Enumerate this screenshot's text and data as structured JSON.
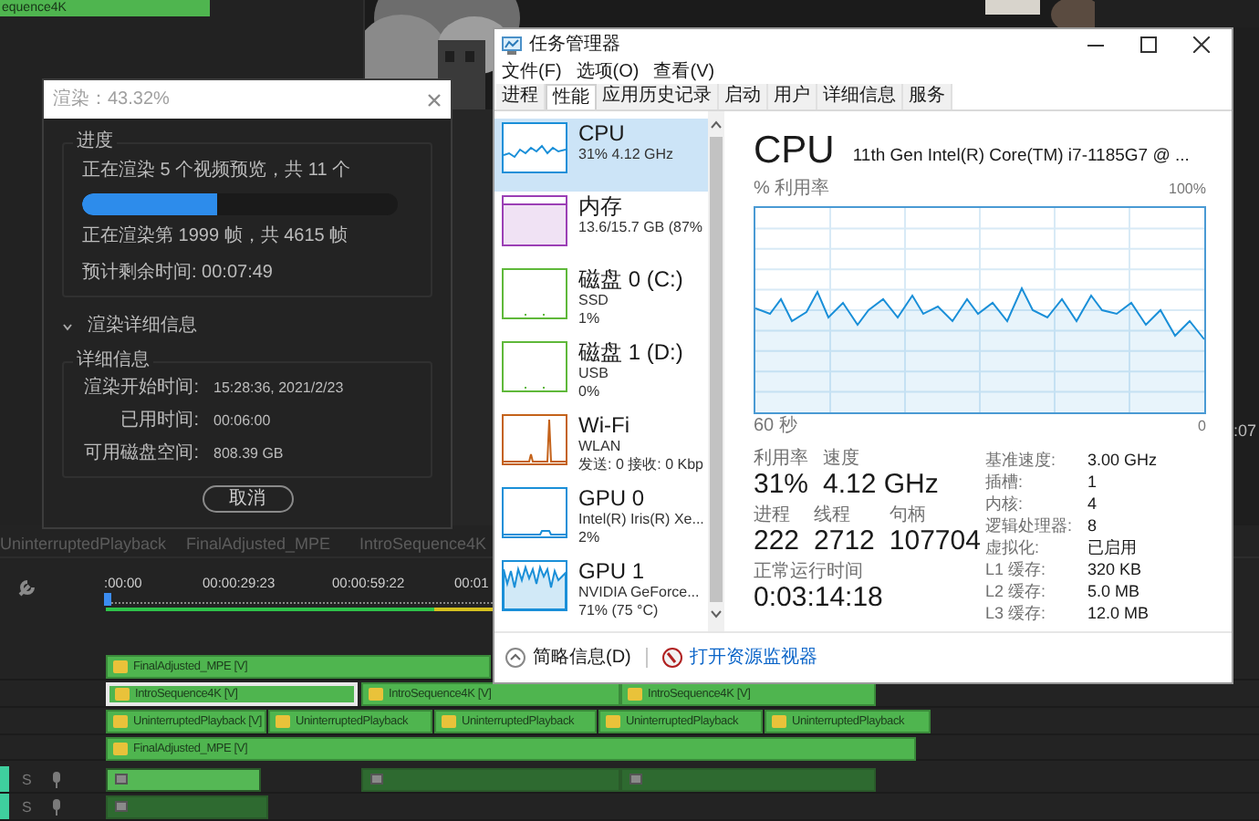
{
  "top_clip": {
    "label": "equence4K"
  },
  "render_dialog": {
    "title": "渲染：43.32%",
    "progress_legend": "进度",
    "status": "正在渲染 5 个视频预览，共 11 个",
    "level": 0.43,
    "frames": "正在渲染第 1999 帧，共 4615 帧",
    "remaining": "预计剩余时间: 00:07:49",
    "details_toggle": {
      "label": "渲染详细信息",
      "expanded": true
    },
    "details_legend": "详细信息",
    "details": [
      {
        "label": "渲染开始时间:",
        "value": "15:28:36, 2021/2/23"
      },
      {
        "label": "已用时间:",
        "value": "00:06:00"
      },
      {
        "label": "可用磁盘空间:",
        "value": "808.39 GB"
      }
    ],
    "cancel_button": "取消"
  },
  "task_manager": {
    "title": "任务管理器",
    "menu": [
      "文件(F)",
      "选项(O)",
      "查看(V)"
    ],
    "tabs": [
      {
        "label": "进程",
        "selected": false
      },
      {
        "label": "性能",
        "selected": true
      },
      {
        "label": "应用历史记录",
        "selected": false
      },
      {
        "label": "启动",
        "selected": false
      },
      {
        "label": "用户",
        "selected": false
      },
      {
        "label": "详细信息",
        "selected": false
      },
      {
        "label": "服务",
        "selected": false
      }
    ],
    "resources": [
      {
        "name": "CPU",
        "lines": [
          "31% 4.12 GHz"
        ],
        "kind": "wave",
        "color": "#1a8fd8",
        "selected": true
      },
      {
        "name": "内存",
        "lines": [
          "13.6/15.7 GB (87%"
        ],
        "kind": "band",
        "color": "#9b3fb5",
        "selected": false
      },
      {
        "name": "磁盘 0 (C:)",
        "lines": [
          "SSD",
          "1%"
        ],
        "kind": "flat",
        "color": "#5fb83a",
        "selected": false
      },
      {
        "name": "磁盘 1 (D:)",
        "lines": [
          "USB",
          "0%"
        ],
        "kind": "flat",
        "color": "#5fb83a",
        "selected": false
      },
      {
        "name": "Wi-Fi",
        "lines": [
          "WLAN",
          "发送: 0 接收: 0 Kbp"
        ],
        "kind": "spikes",
        "color": "#c4621a",
        "selected": false
      },
      {
        "name": "GPU 0",
        "lines": [
          "Intel(R) Iris(R) Xe...",
          "2%"
        ],
        "kind": "low",
        "color": "#1a8fd8",
        "selected": false
      },
      {
        "name": "GPU 1",
        "lines": [
          "NVIDIA GeForce...",
          "71% (75 °C)"
        ],
        "kind": "dense",
        "color": "#1a8fd8",
        "selected": false
      }
    ],
    "detail": {
      "heading": "CPU",
      "model": "11th Gen Intel(R) Core(TM) i7-1185G7 @ ...",
      "graph_label": "% 利用率",
      "graph_max": "100%",
      "graph_time": "60 秒",
      "graph_min": "0",
      "stats": [
        [
          {
            "label": "利用率",
            "value": "31%"
          },
          {
            "label": "速度",
            "value": "4.12 GHz"
          }
        ],
        [
          {
            "label": "进程",
            "value": "222"
          },
          {
            "label": "线程",
            "value": "2712"
          },
          {
            "label": "句柄",
            "value": "107704"
          }
        ]
      ],
      "uptime": {
        "label": "正常运行时间",
        "value": "0:03:14:18"
      },
      "specs": [
        {
          "label": "基准速度:",
          "value": "3.00 GHz"
        },
        {
          "label": "插槽:",
          "value": "1"
        },
        {
          "label": "内核:",
          "value": "4"
        },
        {
          "label": "逻辑处理器:",
          "value": "8"
        },
        {
          "label": "虚拟化:",
          "value": "已启用"
        },
        {
          "label": "L1 缓存:",
          "value": "320 KB"
        },
        {
          "label": "L2 缓存:",
          "value": "5.0 MB"
        },
        {
          "label": "L3 缓存:",
          "value": "12.0 MB"
        }
      ]
    },
    "footer": {
      "collapse": "简略信息(D)",
      "link": "打开资源监视器"
    }
  },
  "timeline": {
    "sequence_tabs": [
      "UninterruptedPlayback",
      "FinalAdjusted_MPE",
      "IntroSequence4K"
    ],
    "timecodes": [
      ":00:00",
      "00:00:29:23",
      "00:00:59:22",
      "00:01"
    ],
    "video_tracks": [
      {
        "clips": [
          {
            "label": "FinalAdjusted_MPE [V]",
            "selected": false
          }
        ]
      },
      {
        "clips": [
          {
            "label": "IntroSequence4K [V]",
            "selected": true
          },
          {
            "label": "IntroSequence4K [V]",
            "selected": false
          },
          {
            "label": "IntroSequence4K [V]",
            "selected": false
          }
        ]
      },
      {
        "clips": [
          {
            "label": "UninterruptedPlayback [V]",
            "selected": false
          },
          {
            "label": "UninterruptedPlayback",
            "selected": false
          },
          {
            "label": "UninterruptedPlayback",
            "selected": false
          },
          {
            "label": "UninterruptedPlayback",
            "selected": false
          },
          {
            "label": "UninterruptedPlayback",
            "selected": false
          }
        ]
      },
      {
        "clips": [
          {
            "label": "FinalAdjusted_MPE [V]",
            "selected": false
          }
        ]
      }
    ],
    "audio_tracks": [
      {
        "label": "S"
      },
      {
        "label": "S"
      }
    ]
  },
  "side_timecode": ":07"
}
